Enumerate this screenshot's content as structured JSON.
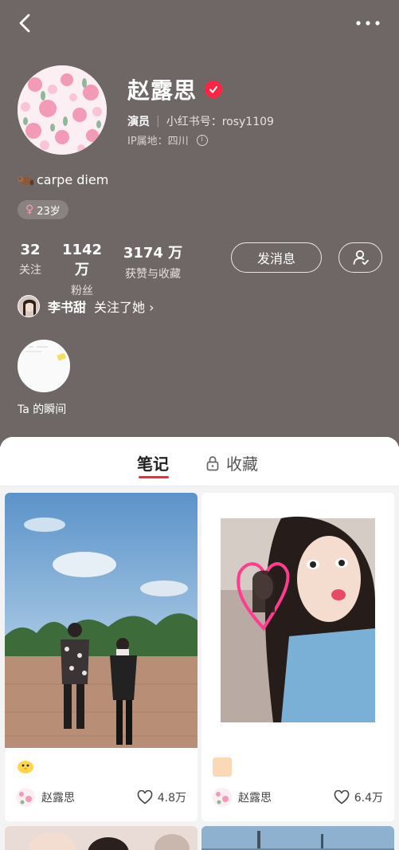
{
  "profile": {
    "name": "赵露思",
    "role": "演员",
    "id_text": "小红书号：rosy1109",
    "ip_text": "IP属地：四川",
    "bio": "carpe diem",
    "age": "23岁"
  },
  "stats": [
    {
      "num": "32",
      "label": "关注"
    },
    {
      "num": "1142 万",
      "label": "粉丝"
    },
    {
      "num": "3174 万",
      "label": "获赞与收藏"
    }
  ],
  "actions": {
    "message": "发消息"
  },
  "friend": {
    "name": "李书甜",
    "text": "关注了她 ›"
  },
  "moment": {
    "label": "Ta 的瞬间"
  },
  "tabs": {
    "notes": "笔记",
    "favorites": "收藏"
  },
  "notes": [
    {
      "author": "赵露思",
      "likes": "4.8万"
    },
    {
      "author": "赵露思",
      "likes": "6.4万"
    }
  ],
  "colors": {
    "header_bg": "#6f6766",
    "accent": "#ff2442"
  },
  "icons": [
    "back-arrow-icon",
    "more-dots-icon",
    "verified-icon",
    "info-icon",
    "female-icon",
    "follow-user-icon",
    "lock-icon",
    "heart-icon"
  ]
}
